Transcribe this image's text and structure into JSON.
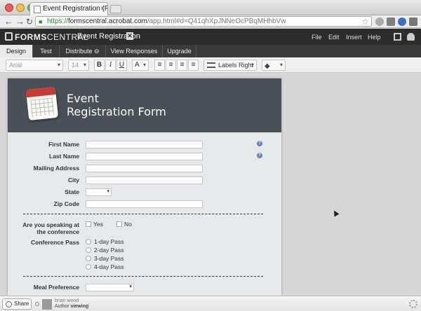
{
  "browser": {
    "tab_title": "Event Registration (Form Fill",
    "tab_close": "×",
    "url": {
      "scheme": "https://",
      "host": "formscentral.acrobat.com",
      "rest": "/app.html#d=Q41qhXpJNNeOcPBqMHhbVw"
    }
  },
  "app": {
    "brand_left": "FORMS",
    "brand_right": "CENTRAL",
    "doc_title": "Event Registration",
    "doc_close": "✕",
    "menu": [
      "File",
      "Edit",
      "Insert",
      "Help"
    ]
  },
  "tabs": {
    "design": "Design",
    "test": "Test",
    "distribute": "Distribute",
    "view_responses": "View Responses",
    "upgrade": "Upgrade"
  },
  "format_toolbar": {
    "font": "Arial",
    "size": "14",
    "bold": "B",
    "italic": "I",
    "underline": "U",
    "color": "A",
    "labels_position": "Labels Right"
  },
  "form": {
    "title_line1": "Event",
    "title_line2": "Registration Form",
    "fields": {
      "first_name": "First Name",
      "last_name": "Last Name",
      "mailing_address": "Mailing Address",
      "city": "City",
      "state": "State",
      "zip_code": "Zip Code",
      "speaking_line1": "Are you speaking at",
      "speaking_line2": "the conference",
      "conference_pass": "Conference Pass",
      "meal_preference": "Meal Preference"
    },
    "speaking_options": [
      "Yes",
      "No"
    ],
    "pass_options": [
      "1-day Pass",
      "2-day Pass",
      "3-day Pass",
      "4-day Pass"
    ],
    "help_glyph": "?"
  },
  "footer": {
    "share": "Share",
    "user_name": "brian wood",
    "role_label": "Author",
    "role_status": "viewing"
  },
  "colors": {
    "header_bg": "#4a5057",
    "form_bg": "#e6e9ec",
    "app_bar": "#2c2c2c",
    "accent_help": "#6a82b1"
  }
}
